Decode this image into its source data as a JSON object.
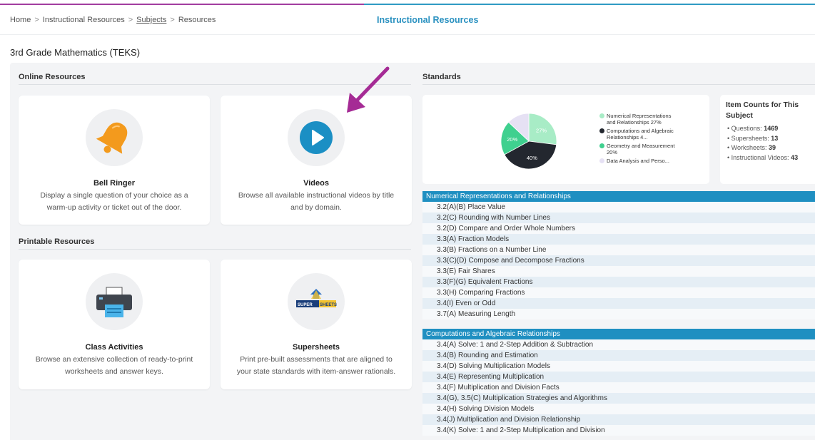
{
  "breadcrumbs": [
    "Home",
    "Instructional Resources",
    "Subjects",
    "Resources"
  ],
  "header_title": "Instructional Resources",
  "subject_title": "3rd Grade Mathematics (TEKS)",
  "online_resources": {
    "heading": "Online Resources",
    "cards": [
      {
        "title": "Bell Ringer",
        "desc": "Display a single question of your choice as a warm-up activity or ticket out of the door.",
        "icon": "bell-icon"
      },
      {
        "title": "Videos",
        "desc": "Browse all available instructional videos by title and by domain.",
        "icon": "play-icon"
      }
    ]
  },
  "printable_resources": {
    "heading": "Printable Resources",
    "cards": [
      {
        "title": "Class Activities",
        "desc": "Browse an extensive collection of ready-to-print worksheets and answer keys.",
        "icon": "printer-icon"
      },
      {
        "title": "Supersheets",
        "desc": "Print pre-built assessments that are aligned to your state standards with item-answer rationals.",
        "icon": "supersheets-logo-icon"
      }
    ]
  },
  "standards": {
    "heading": "Standards",
    "chart_data": {
      "type": "pie",
      "slices": [
        {
          "label": "Numerical Representations and Relationships 27%",
          "value": 27,
          "color": "#a8ecc6",
          "shown": "27%"
        },
        {
          "label": "Computations and Algebraic Relationships 4...",
          "value": 40,
          "color": "#23272f",
          "shown": "40%"
        },
        {
          "label": "Geometry and Measurement 20%",
          "value": 20,
          "color": "#3fd08f",
          "shown": "20%"
        },
        {
          "label": "Data Analysis and Perso...",
          "value": 13,
          "color": "#e6e1f4",
          "shown": ""
        }
      ]
    },
    "item_counts": {
      "heading": "Item Counts for This Subject",
      "items": [
        {
          "label": "Questions:",
          "value": "1469"
        },
        {
          "label": "Supersheets:",
          "value": "13"
        },
        {
          "label": "Worksheets:",
          "value": "39"
        },
        {
          "label": "Instructional Videos:",
          "value": "43"
        }
      ]
    },
    "domains": [
      {
        "title": "Numerical Representations and Relationships",
        "items": [
          "3.2(A)(B) Place Value",
          "3.2(C) Rounding with Number Lines",
          "3.2(D) Compare and Order Whole Numbers",
          "3.3(A) Fraction Models",
          "3.3(B) Fractions on a Number Line",
          "3.3(C)(D) Compose and Decompose Fractions",
          "3.3(E) Fair Shares",
          "3.3(F)(G) Equivalent Fractions",
          "3.3(H) Comparing Fractions",
          "3.4(I) Even or Odd",
          "3.7(A) Measuring Length"
        ]
      },
      {
        "title": "Computations and Algebraic Relationships",
        "items": [
          "3.4(A) Solve: 1 and 2-Step Addition & Subtraction",
          "3.4(B) Rounding and Estimation",
          "3.4(D) Solving Multiplication Models",
          "3.4(E) Representing Multiplication",
          "3.4(F) Multiplication and Division Facts",
          "3.4(G), 3.5(C) Multiplication Strategies and Algorithms",
          "3.4(H) Solving Division Models",
          "3.4(J) Multiplication and Division Relationship",
          "3.4(K) Solve: 1 and 2-Step Multiplication and Division"
        ]
      }
    ]
  },
  "colors": {
    "accent_blue": "#1f8fc1",
    "accent_purple": "#a23d9f",
    "bell_orange": "#f39a1d",
    "play_blue": "#1b8fc4"
  }
}
